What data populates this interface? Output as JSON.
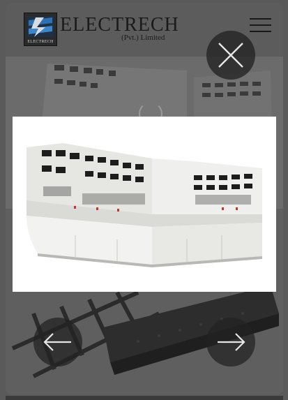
{
  "header": {
    "logo_mark_caption": "ELECTRECH",
    "company_name": "ELECTRECH",
    "company_suffix": "(Pvt.) Limited",
    "menu_icon": "hamburger-menu-icon"
  },
  "lightbox": {
    "close_icon": "close-icon",
    "prev_icon": "arrow-left-icon",
    "next_icon": "arrow-right-icon",
    "loading_icon": "spinner-icon",
    "image_subject": "control-panel-desk"
  },
  "colors": {
    "overlay": "#4a4a4a",
    "header_bg": "#5c5c5c",
    "button_bg": "#232323",
    "icon_stroke": "#e6e6e6",
    "lightbox_bg": "#ffffff",
    "brand_blue": "#2f6fb3"
  }
}
